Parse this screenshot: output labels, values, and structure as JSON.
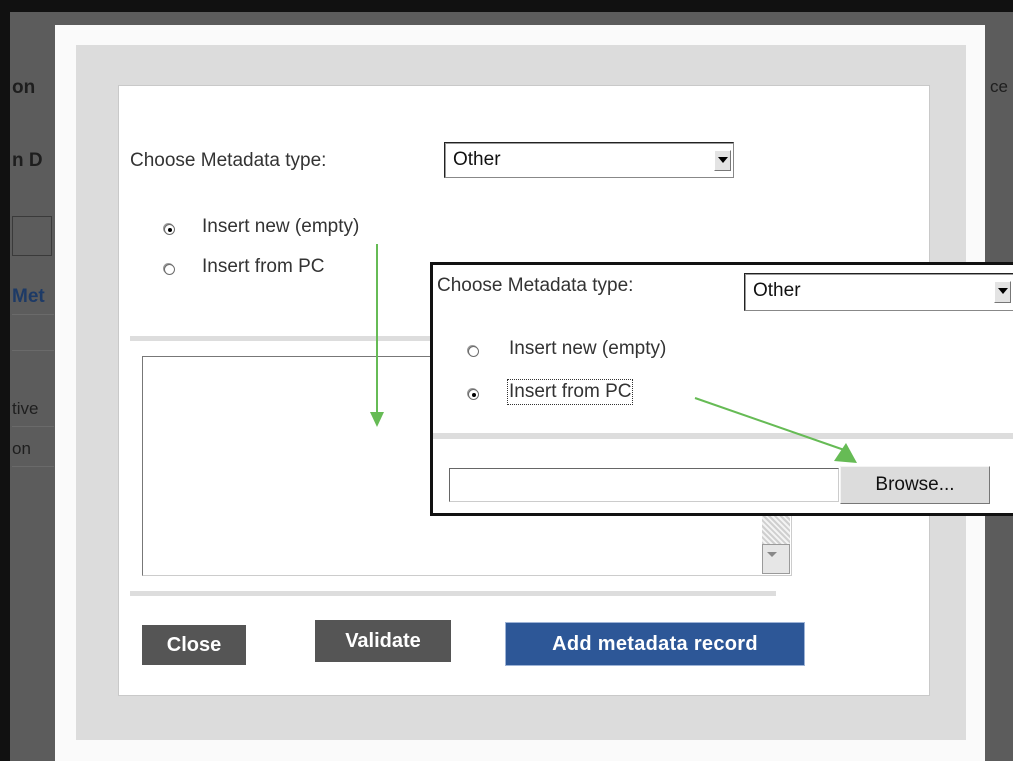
{
  "background_page": {
    "fragments": {
      "top_right": "ce",
      "row1": "on",
      "row2": "n D",
      "row3_link": "Met",
      "row4": "tive",
      "row5": "on"
    }
  },
  "dialog": {
    "metadata_type_label": "Choose Metadata type:",
    "metadata_type_value": "Other",
    "radio_new_label": "Insert new (empty)",
    "radio_pc_label": "Insert from PC",
    "radio_selected": "new",
    "buttons": {
      "close": "Close",
      "validate": "Validate",
      "add_record": "Add metadata record"
    }
  },
  "inset": {
    "metadata_type_label": "Choose Metadata type:",
    "metadata_type_value": "Other",
    "radio_new_label": "Insert new (empty)",
    "radio_pc_label": "Insert from PC",
    "radio_selected": "pc",
    "file_input_value": "",
    "browse_label": "Browse..."
  },
  "colors": {
    "overlay_backdrop": "#5c5c5c",
    "button_dark": "#555555",
    "button_blue": "#2d5797",
    "annotation_arrow": "#66bb55"
  },
  "icons": {
    "select_arrow": "chevron-down-icon",
    "annotation_arrow": "arrow-icon"
  }
}
